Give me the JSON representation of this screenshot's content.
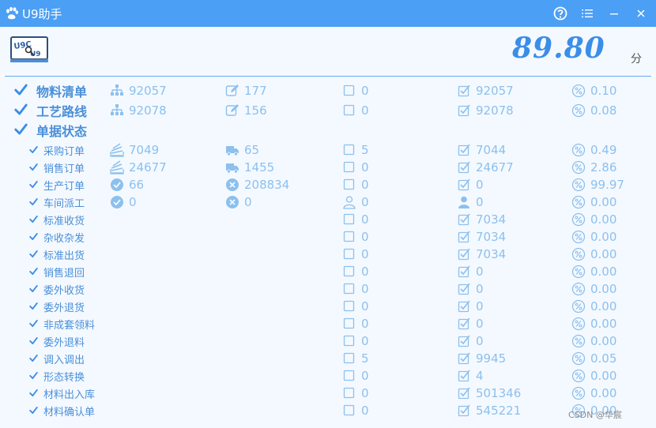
{
  "window": {
    "title": "U9助手",
    "buttons": [
      "help-icon",
      "menu-icon",
      "minimize-icon",
      "close-icon"
    ]
  },
  "header": {
    "logo_text": "U9C U9",
    "score": "89.80",
    "score_unit": "分"
  },
  "colors": {
    "titlebar": "#4b9ff5",
    "accent": "#3a8ee8",
    "label": "#4b8fd8",
    "value": "#8cc0ee",
    "background": "#f4f9ff"
  },
  "rows": [
    {
      "label": "物料清单",
      "level": "big",
      "cells": [
        {
          "icon": "hierarchy-icon",
          "value": "92057"
        },
        {
          "icon": "edit-icon",
          "value": "177"
        },
        {
          "icon": "checkbox-empty-icon",
          "value": "0"
        },
        {
          "icon": "checkbox-checked-icon",
          "value": "92057"
        },
        {
          "icon": "percent-icon",
          "value": "0.10"
        }
      ]
    },
    {
      "label": "工艺路线",
      "level": "big",
      "cells": [
        {
          "icon": "hierarchy-icon",
          "value": "92078"
        },
        {
          "icon": "edit-icon",
          "value": "156"
        },
        {
          "icon": "checkbox-empty-icon",
          "value": "0"
        },
        {
          "icon": "checkbox-checked-icon",
          "value": "92078"
        },
        {
          "icon": "percent-icon",
          "value": "0.08"
        }
      ]
    },
    {
      "label": "单据状态",
      "level": "big",
      "cells": []
    },
    {
      "label": "采购订单",
      "level": "sub",
      "cells": [
        {
          "icon": "stack-icon",
          "value": "7049"
        },
        {
          "icon": "truck-icon",
          "value": "65"
        },
        {
          "icon": "checkbox-empty-icon",
          "value": "5"
        },
        {
          "icon": "checkbox-checked-icon",
          "value": "7044"
        },
        {
          "icon": "percent-icon",
          "value": "0.49"
        }
      ]
    },
    {
      "label": "销售订单",
      "level": "sub",
      "cells": [
        {
          "icon": "stack-icon",
          "value": "24677"
        },
        {
          "icon": "truck-icon",
          "value": "1455"
        },
        {
          "icon": "checkbox-empty-icon",
          "value": "0"
        },
        {
          "icon": "checkbox-checked-icon",
          "value": "24677"
        },
        {
          "icon": "percent-icon",
          "value": "2.86"
        }
      ]
    },
    {
      "label": "生产订单",
      "level": "sub",
      "cells": [
        {
          "icon": "check-circle-icon",
          "value": "66"
        },
        {
          "icon": "x-circle-icon",
          "value": "208834"
        },
        {
          "icon": "checkbox-empty-icon",
          "value": "0"
        },
        {
          "icon": "checkbox-checked-icon",
          "value": "0"
        },
        {
          "icon": "percent-icon",
          "value": "99.97"
        }
      ]
    },
    {
      "label": "车间派工",
      "level": "sub",
      "cells": [
        {
          "icon": "check-circle-icon",
          "value": "0"
        },
        {
          "icon": "x-circle-icon",
          "value": "0"
        },
        {
          "icon": "user-outline-icon",
          "value": "0"
        },
        {
          "icon": "user-filled-icon",
          "value": "0"
        },
        {
          "icon": "percent-icon",
          "value": "0.00"
        }
      ]
    },
    {
      "label": "标准收货",
      "level": "sub",
      "cells": [
        null,
        null,
        {
          "icon": "checkbox-empty-icon",
          "value": "0"
        },
        {
          "icon": "checkbox-checked-icon",
          "value": "7034"
        },
        {
          "icon": "percent-icon",
          "value": "0.00"
        }
      ]
    },
    {
      "label": "杂收杂发",
      "level": "sub",
      "cells": [
        null,
        null,
        {
          "icon": "checkbox-empty-icon",
          "value": "0"
        },
        {
          "icon": "checkbox-checked-icon",
          "value": "7034"
        },
        {
          "icon": "percent-icon",
          "value": "0.00"
        }
      ]
    },
    {
      "label": "标准出货",
      "level": "sub",
      "cells": [
        null,
        null,
        {
          "icon": "checkbox-empty-icon",
          "value": "0"
        },
        {
          "icon": "checkbox-checked-icon",
          "value": "7034"
        },
        {
          "icon": "percent-icon",
          "value": "0.00"
        }
      ]
    },
    {
      "label": "销售退回",
      "level": "sub",
      "cells": [
        null,
        null,
        {
          "icon": "checkbox-empty-icon",
          "value": "0"
        },
        {
          "icon": "checkbox-checked-icon",
          "value": "0"
        },
        {
          "icon": "percent-icon",
          "value": "0.00"
        }
      ]
    },
    {
      "label": "委外收货",
      "level": "sub",
      "cells": [
        null,
        null,
        {
          "icon": "checkbox-empty-icon",
          "value": "0"
        },
        {
          "icon": "checkbox-checked-icon",
          "value": "0"
        },
        {
          "icon": "percent-icon",
          "value": "0.00"
        }
      ]
    },
    {
      "label": "委外退货",
      "level": "sub",
      "cells": [
        null,
        null,
        {
          "icon": "checkbox-empty-icon",
          "value": "0"
        },
        {
          "icon": "checkbox-checked-icon",
          "value": "0"
        },
        {
          "icon": "percent-icon",
          "value": "0.00"
        }
      ]
    },
    {
      "label": "非成套领料",
      "level": "sub",
      "cells": [
        null,
        null,
        {
          "icon": "checkbox-empty-icon",
          "value": "0"
        },
        {
          "icon": "checkbox-checked-icon",
          "value": "0"
        },
        {
          "icon": "percent-icon",
          "value": "0.00"
        }
      ]
    },
    {
      "label": "委外退料",
      "level": "sub",
      "cells": [
        null,
        null,
        {
          "icon": "checkbox-empty-icon",
          "value": "0"
        },
        {
          "icon": "checkbox-checked-icon",
          "value": "0"
        },
        {
          "icon": "percent-icon",
          "value": "0.00"
        }
      ]
    },
    {
      "label": "调入调出",
      "level": "sub",
      "cells": [
        null,
        null,
        {
          "icon": "checkbox-empty-icon",
          "value": "5"
        },
        {
          "icon": "checkbox-checked-icon",
          "value": "9945"
        },
        {
          "icon": "percent-icon",
          "value": "0.05"
        }
      ]
    },
    {
      "label": "形态转换",
      "level": "sub",
      "cells": [
        null,
        null,
        {
          "icon": "checkbox-empty-icon",
          "value": "0"
        },
        {
          "icon": "checkbox-checked-icon",
          "value": "4"
        },
        {
          "icon": "percent-icon",
          "value": "0.00"
        }
      ]
    },
    {
      "label": "材料出入库",
      "level": "sub",
      "cells": [
        null,
        null,
        {
          "icon": "checkbox-empty-icon",
          "value": "0"
        },
        {
          "icon": "checkbox-checked-icon",
          "value": "501346"
        },
        {
          "icon": "percent-icon",
          "value": "0.00"
        }
      ]
    },
    {
      "label": "材料确认单",
      "level": "sub",
      "cells": [
        null,
        null,
        {
          "icon": "checkbox-empty-icon",
          "value": "0"
        },
        {
          "icon": "checkbox-checked-icon",
          "value": "545221"
        },
        {
          "icon": "percent-icon",
          "value": "0.00"
        }
      ]
    }
  ],
  "watermark": "CSDN @华宸"
}
